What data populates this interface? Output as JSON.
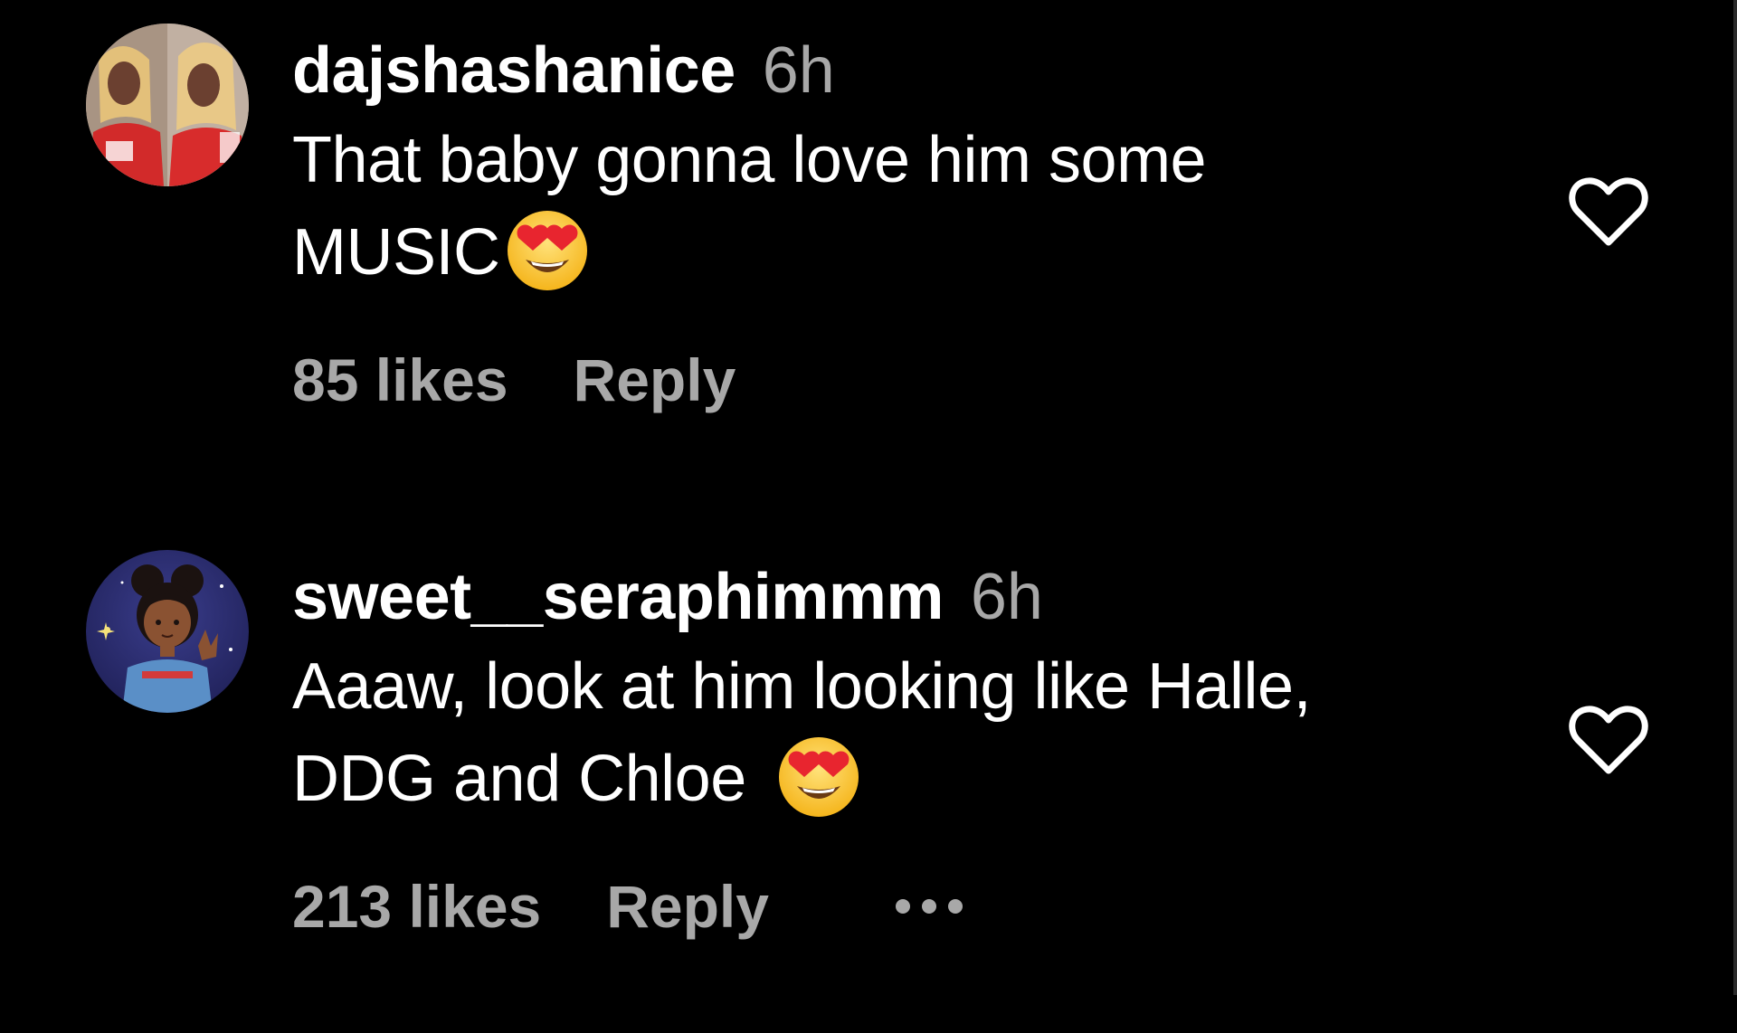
{
  "comments": [
    {
      "username": "dajshashanice",
      "time": "6h",
      "text_line1": "That baby gonna love him some",
      "text_line2": "MUSIC",
      "emoji": "heart-eyes-emoji",
      "likes": "85 likes",
      "reply": "Reply",
      "avatar": "avatar-photo",
      "like_icon": "heart-outline-icon"
    },
    {
      "username": "sweet__seraphimmm",
      "time": "6h",
      "text_line1": "Aaaw, look at him looking like Halle,",
      "text_line2": "DDG and Chloe",
      "emoji": "heart-eyes-emoji",
      "likes": "213 likes",
      "reply": "Reply",
      "more_icon": "more-options-icon",
      "avatar": "avatar-anime-illustration",
      "like_icon": "heart-outline-icon"
    }
  ],
  "colors": {
    "background": "#000000",
    "primary_text": "#ffffff",
    "secondary_text": "#a8a8a8"
  }
}
